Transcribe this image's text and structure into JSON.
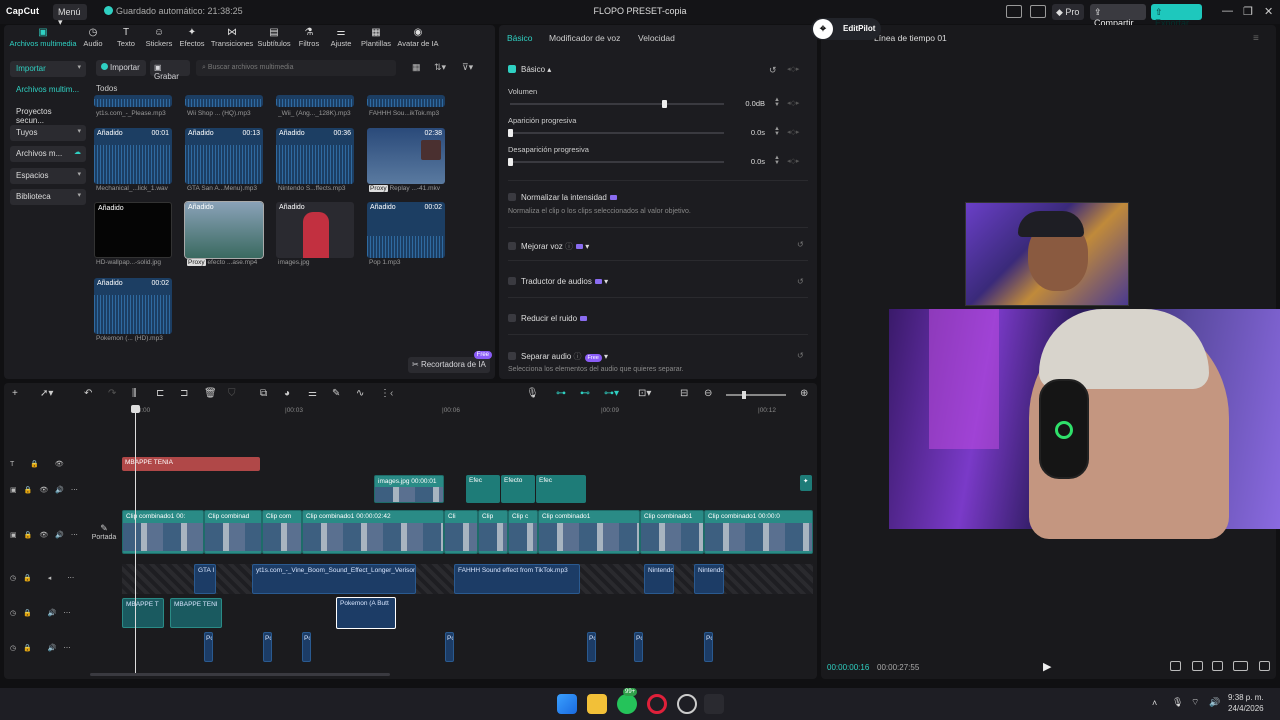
{
  "app": {
    "logo": "CapCut",
    "menu": "Menú",
    "autosave": "Guardado automático: 21:38:25",
    "project_title": "FLOPO PRESET-copia",
    "pro": "Pro",
    "share": "Compartir",
    "export": "Exportar"
  },
  "toolbar": [
    {
      "label": "Archivos multimedia",
      "icon": "media-icon"
    },
    {
      "label": "Audio",
      "icon": "audio-icon"
    },
    {
      "label": "Texto",
      "icon": "text-icon"
    },
    {
      "label": "Stickers",
      "icon": "sticker-icon"
    },
    {
      "label": "Efectos",
      "icon": "effects-icon"
    },
    {
      "label": "Transiciones",
      "icon": "transition-icon"
    },
    {
      "label": "Subtítulos",
      "icon": "subtitle-icon"
    },
    {
      "label": "Filtros",
      "icon": "filter-icon"
    },
    {
      "label": "Ajuste",
      "icon": "adjust-icon"
    },
    {
      "label": "Plantillas",
      "icon": "template-icon"
    },
    {
      "label": "Avatar de IA",
      "icon": "avatar-icon"
    }
  ],
  "sidenav": [
    {
      "label": "Importar"
    },
    {
      "label": "Archivos multim..."
    },
    {
      "label": "Proyectos secun..."
    },
    {
      "label": "Tuyos"
    },
    {
      "label": "Archivos m..."
    },
    {
      "label": "Espacios"
    },
    {
      "label": "Biblioteca"
    }
  ],
  "media": {
    "import": "Importar",
    "record": "Grabar",
    "search_placeholder": "Buscar archivos multimedia",
    "all": "Todos",
    "top_row": [
      "yt1s.com_-_Please.mp3",
      "Wii Shop ... (HQ).mp3",
      "_Wii_ (Ang..._128K).mp3",
      "FAHHH Sou...ikTok.mp3"
    ],
    "items": [
      {
        "tag": "Añadido",
        "dur": "00:01",
        "name": "Mechanical_...lick_1.wav",
        "kind": "audio"
      },
      {
        "tag": "Añadido",
        "dur": "00:13",
        "name": "GTA San A...Menu).mp3",
        "kind": "audio"
      },
      {
        "tag": "Añadido",
        "dur": "00:36",
        "name": "Nintendo S...ffects.mp3",
        "kind": "audio"
      },
      {
        "tag": "",
        "dur": "02:38",
        "name": "Replay ...-41.mkv",
        "kind": "video",
        "proxy": "Proxy"
      },
      {
        "tag": "Añadido",
        "dur": "",
        "name": "HD-wallpap...-solid.jpg",
        "kind": "black"
      },
      {
        "tag": "Añadido",
        "dur": "",
        "name": "efecto ...ase.mp4",
        "kind": "video2",
        "proxy": "Proxy"
      },
      {
        "tag": "Añadido",
        "dur": "",
        "name": "images.jpg",
        "kind": "person"
      },
      {
        "tag": "Añadido",
        "dur": "00:02",
        "name": "Pop 1.mp3",
        "kind": "audio"
      },
      {
        "tag": "Añadido",
        "dur": "00:02",
        "name": "Pokemon (... (HD).mp3",
        "kind": "audio"
      }
    ],
    "ai_cutter": "Recortadora de IA",
    "free": "Free"
  },
  "props": {
    "tabs": [
      "Básico",
      "Modificador de voz",
      "Velocidad"
    ],
    "section": "Básico",
    "volume": {
      "label": "Volumen",
      "value": "0.0dB",
      "level": 0.72
    },
    "fade_in": {
      "label": "Aparición progresiva",
      "value": "0.0s",
      "level": 0
    },
    "fade_out": {
      "label": "Desaparición progresiva",
      "value": "0.0s",
      "level": 0
    },
    "normalize": {
      "label": "Normalizar la intensidad",
      "desc": "Normaliza el clip o los clips seleccionados al valor objetivo."
    },
    "enhance": "Mejorar voz",
    "translator": "Traductor de audios",
    "noise": "Reducir el ruido",
    "separate": {
      "label": "Separar audio",
      "badge": "Free",
      "desc": "Selecciona los elementos del audio que quieres separar."
    }
  },
  "preview": {
    "editpilot": "EditPilot",
    "timeline_name": "Línea de tiempo 01",
    "current": "00:00:00:16",
    "total": "00:00:27:55"
  },
  "timeline": {
    "ruler": [
      "00:00",
      "|00:03",
      "|00:06",
      "|00:09",
      "|00:12"
    ],
    "cover": "Portada",
    "text_clip": "MBAPPE TENIA",
    "overlay_clips": [
      "images.jpg  00:00:01",
      "Efec",
      "Efecto",
      "Efec"
    ],
    "main_clips": [
      "Clip combinado1  00:",
      "Clip combinad",
      "Clip com",
      "Clip combinado1  00:00:02:42",
      "Cli",
      "Clip",
      "Clip c",
      "Clip combinado1",
      "Clip combinado1",
      "Clip combinado1  00:00:0"
    ],
    "audio1": [
      "GTA I",
      "yt1s.com_-_Vine_Boom_Sound_Effect_Longer_Verison",
      "FAHHH Sound effect from TikTok.mp3",
      "Nintendo",
      "Nintendo"
    ],
    "audio2": [
      "MBAPPE T",
      "MBAPPE TENI",
      "Pokemon (A Butt"
    ],
    "audio3": [
      "Po",
      "Po",
      "Po",
      "Po",
      "Po",
      "Po",
      "Po"
    ]
  },
  "taskbar": {
    "time": "9:38 p. m.",
    "date": "24/4/2026",
    "badge": "99+"
  },
  "colors": {
    "accent": "#2fd0c2",
    "text_clip": "#b04848",
    "video_clip": "#2a8b86",
    "audio_clip": "#1c3c66",
    "export": "#1ec8bd"
  }
}
